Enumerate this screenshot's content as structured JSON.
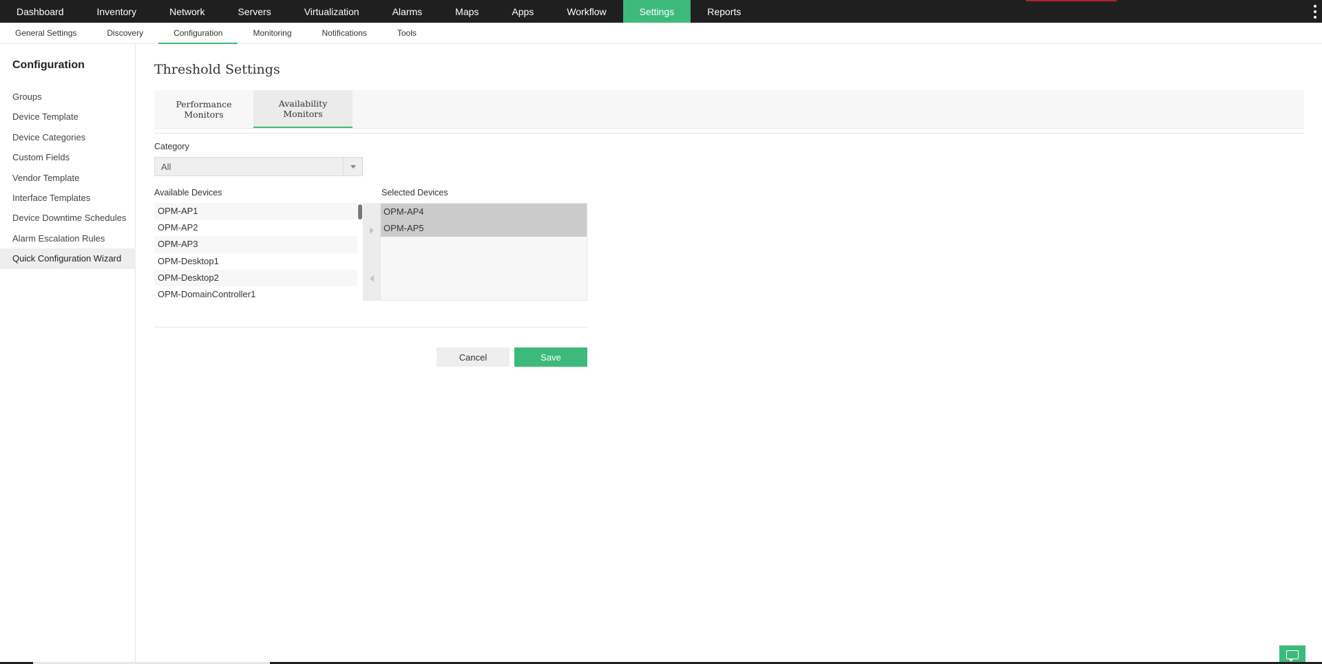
{
  "topnav": {
    "items": [
      {
        "label": "Dashboard",
        "active": false
      },
      {
        "label": "Inventory",
        "active": false
      },
      {
        "label": "Network",
        "active": false
      },
      {
        "label": "Servers",
        "active": false
      },
      {
        "label": "Virtualization",
        "active": false
      },
      {
        "label": "Alarms",
        "active": false
      },
      {
        "label": "Maps",
        "active": false
      },
      {
        "label": "Apps",
        "active": false
      },
      {
        "label": "Workflow",
        "active": false
      },
      {
        "label": "Settings",
        "active": true
      },
      {
        "label": "Reports",
        "active": false
      }
    ],
    "accent_color": "#3dba7b"
  },
  "subnav": {
    "items": [
      {
        "label": "General Settings",
        "active": false
      },
      {
        "label": "Discovery",
        "active": false
      },
      {
        "label": "Configuration",
        "active": true
      },
      {
        "label": "Monitoring",
        "active": false
      },
      {
        "label": "Notifications",
        "active": false
      },
      {
        "label": "Tools",
        "active": false
      }
    ]
  },
  "sidebar": {
    "title": "Configuration",
    "items": [
      {
        "label": "Groups",
        "active": false
      },
      {
        "label": "Device Template",
        "active": false
      },
      {
        "label": "Device Categories",
        "active": false
      },
      {
        "label": "Custom Fields",
        "active": false
      },
      {
        "label": "Vendor Template",
        "active": false
      },
      {
        "label": "Interface Templates",
        "active": false
      },
      {
        "label": "Device Downtime Schedules",
        "active": false
      },
      {
        "label": "Alarm Escalation Rules",
        "active": false
      },
      {
        "label": "Quick Configuration Wizard",
        "active": true
      }
    ]
  },
  "main": {
    "title": "Threshold Settings",
    "tabs": [
      {
        "line1": "Performance",
        "line2": "Monitors",
        "active": false
      },
      {
        "line1": "Availability",
        "line2": "Monitors",
        "active": true
      }
    ],
    "category": {
      "label": "Category",
      "value": "All"
    },
    "available": {
      "label": "Available Devices",
      "items": [
        "OPM-AP1",
        "OPM-AP2",
        "OPM-AP3",
        "OPM-Desktop1",
        "OPM-Desktop2",
        "OPM-DomainController1"
      ]
    },
    "selected": {
      "label": "Selected Devices",
      "items": [
        "OPM-AP4",
        "OPM-AP5"
      ]
    },
    "buttons": {
      "cancel": "Cancel",
      "save": "Save"
    }
  },
  "icons": {
    "kebab": "vertical-dots-icon",
    "select_arrow": "caret-down-icon",
    "move_right": "arrow-right-icon",
    "move_left": "arrow-left-icon",
    "chat": "chat-icon"
  }
}
